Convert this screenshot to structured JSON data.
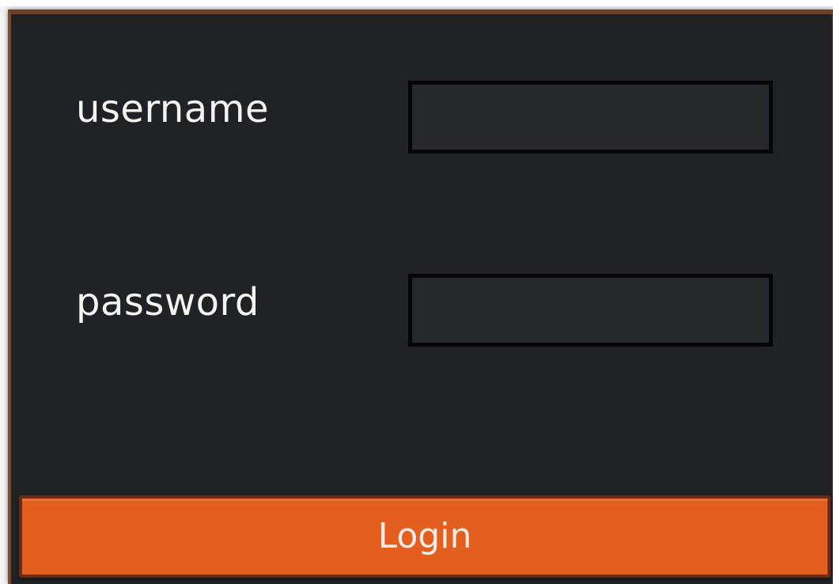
{
  "form": {
    "username_label": "username",
    "password_label": "password",
    "username_value": "",
    "password_value": "",
    "login_label": "Login"
  },
  "colors": {
    "panel_background": "#212226",
    "field_background": "#26282c",
    "field_border": "#050505",
    "button_background": "#e35f1f",
    "label_text": "#f4f3ef",
    "accent_border": "#7a4a33"
  }
}
